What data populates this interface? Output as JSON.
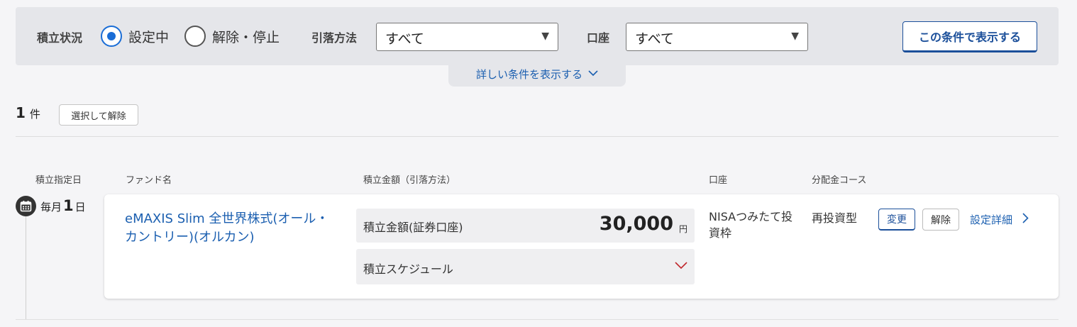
{
  "filter": {
    "status_label": "積立状況",
    "status_options": [
      {
        "label": "設定中",
        "selected": true
      },
      {
        "label": "解除・停止",
        "selected": false
      }
    ],
    "withdrawal_label": "引落方法",
    "withdrawal_value": "すべて",
    "account_label": "口座",
    "account_value": "すべて",
    "apply_button": "この条件で表示する",
    "more_conditions": "詳しい条件を表示する"
  },
  "results": {
    "count": "1",
    "count_unit": "件",
    "clear_selected_button": "選択して解除"
  },
  "columns": {
    "date": "積立指定日",
    "fund": "ファンド名",
    "amount": "積立金額（引落方法）",
    "account": "口座",
    "course": "分配金コース"
  },
  "rows": [
    {
      "date_prefix": "毎月",
      "date_num": "1",
      "date_suffix": "日",
      "fund_name": "eMAXIS Slim 全世界株式(オール・カントリー)(オルカン)",
      "amount_label": "積立金額(証券口座)",
      "amount_value": "30,000",
      "amount_unit": "円",
      "schedule_label": "積立スケジュール",
      "account": "NISAつみたて投資枠",
      "course": "再投資型",
      "change_button": "変更",
      "cancel_button": "解除",
      "detail_link": "設定詳細"
    }
  ],
  "colors": {
    "accent": "#1a6dd6",
    "link": "#1b5fb0",
    "button_primary": "#1b4f9a",
    "panel_bg": "#e5e6ea",
    "schedule_chevron": "#c0282d"
  },
  "icons": {
    "calendar": "calendar-icon",
    "dropdown": "triangle-down-icon",
    "more_chevron": "chevron-down-icon",
    "detail_chevron": "chevron-right-icon"
  }
}
